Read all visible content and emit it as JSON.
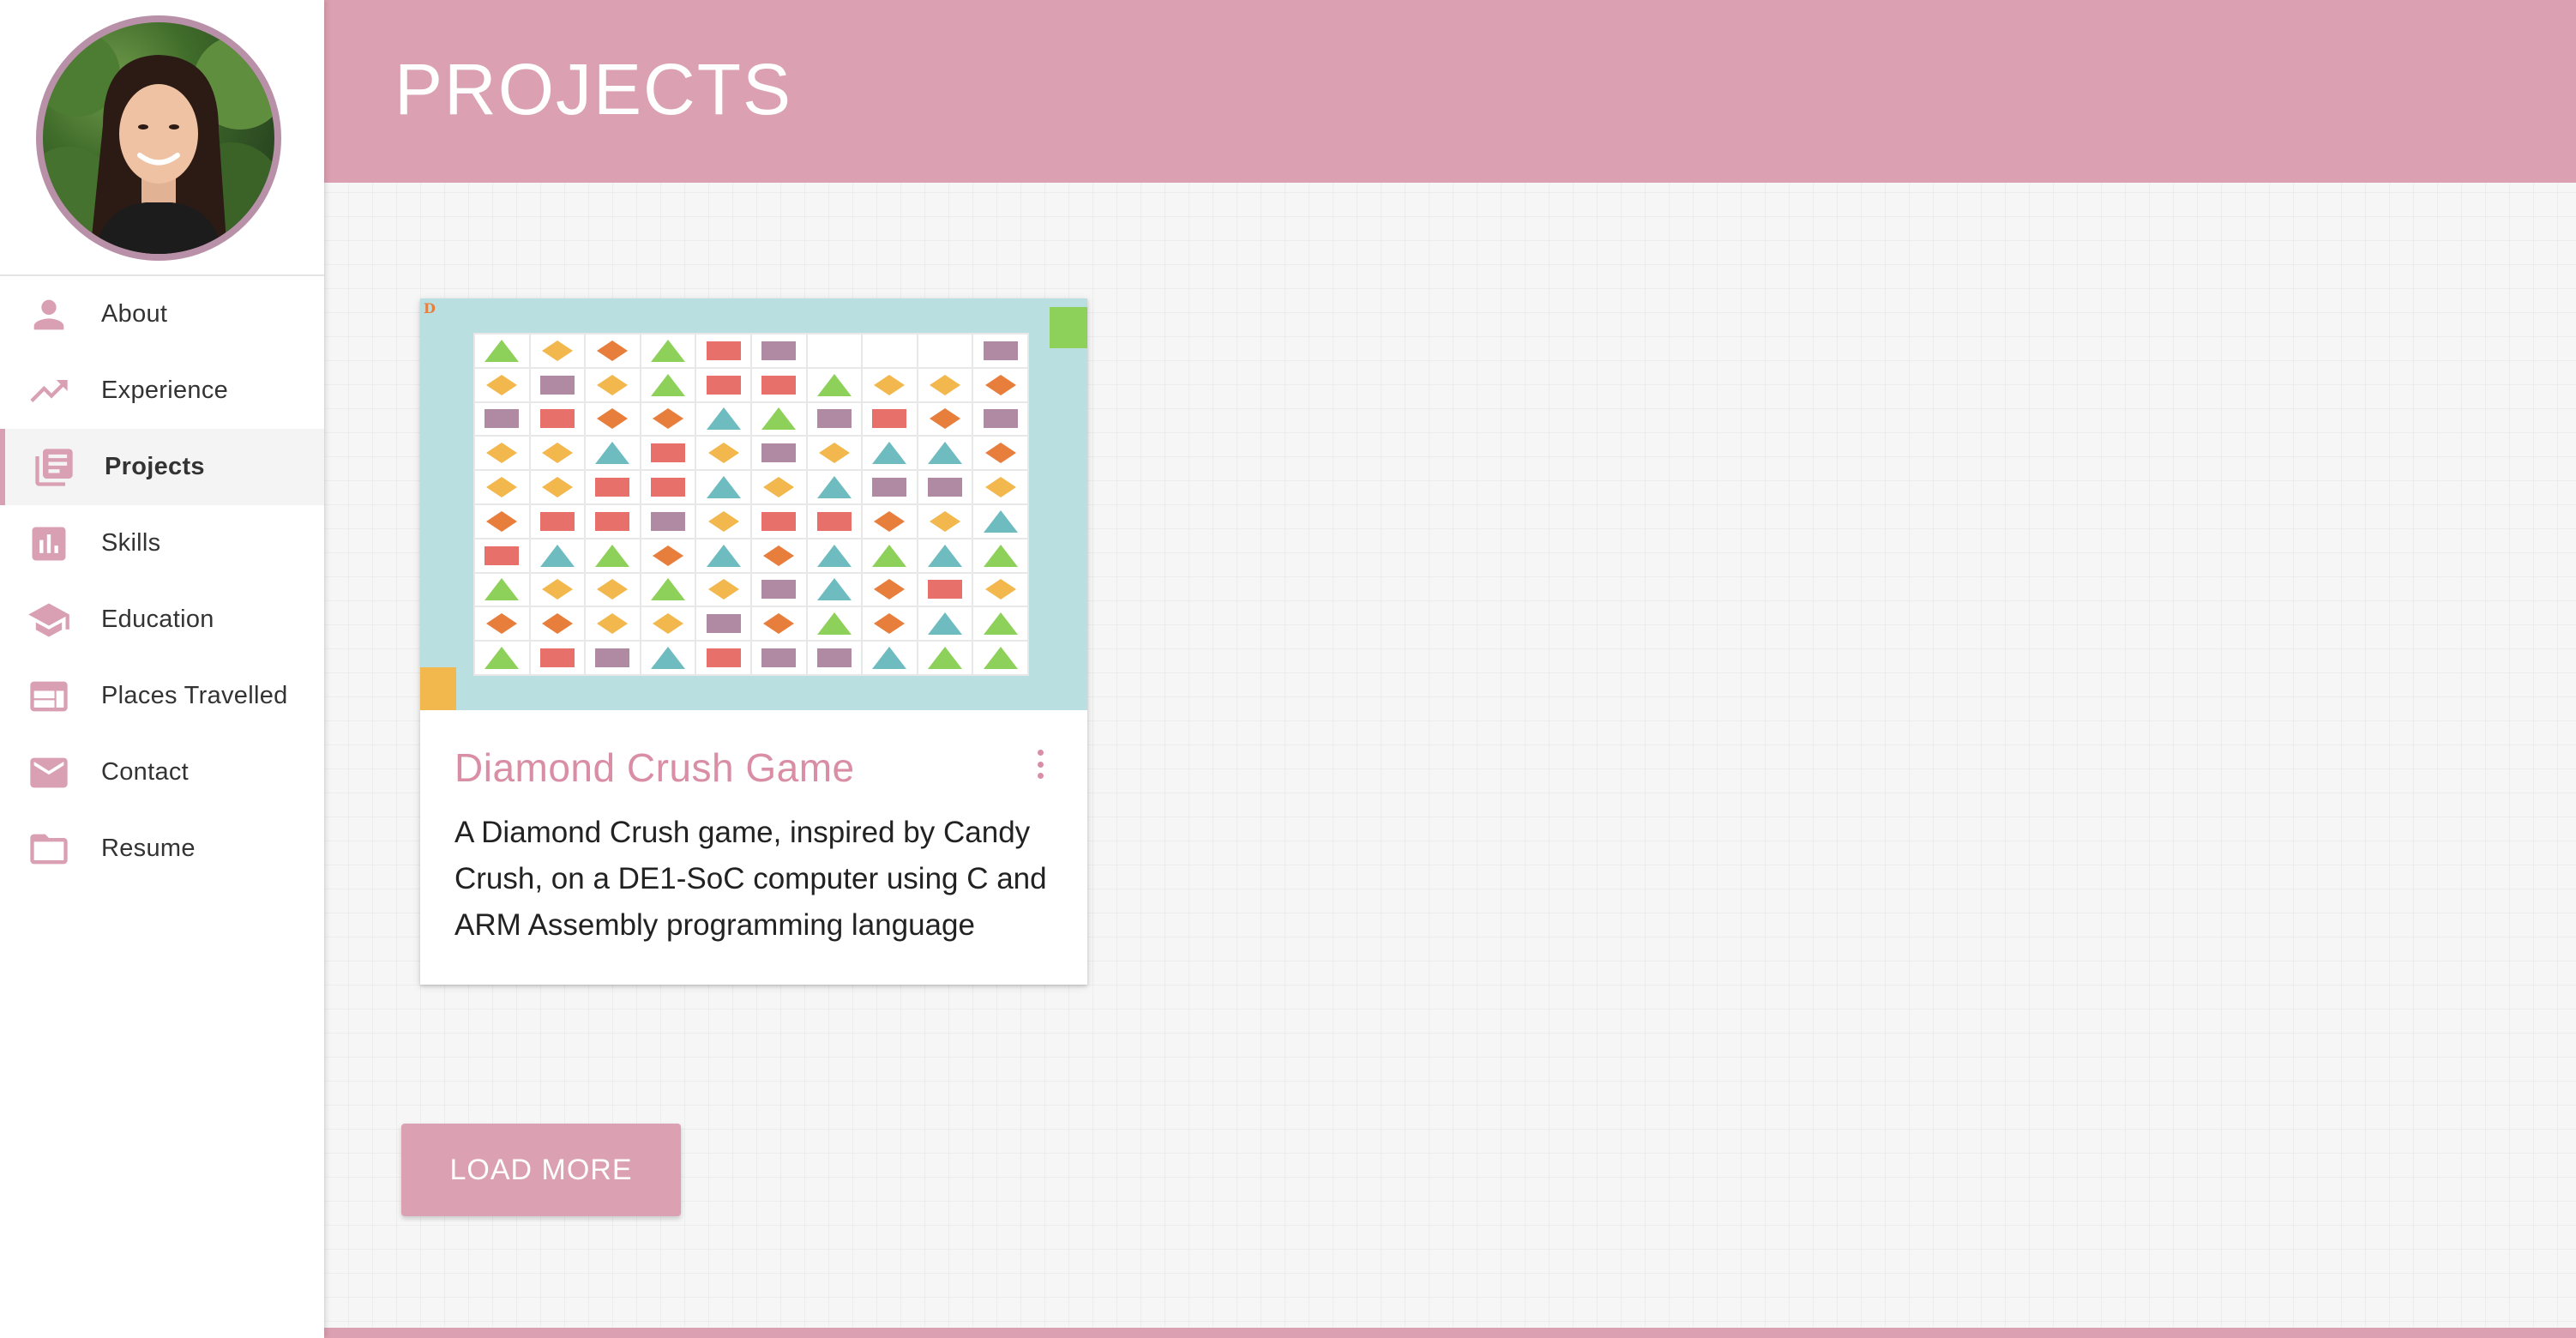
{
  "theme": {
    "accent": "#dba1b2",
    "accent_text": "#d98ea6",
    "icon": "#d9a0b4"
  },
  "sidebar": {
    "items": [
      {
        "label": "About",
        "icon": "person-icon"
      },
      {
        "label": "Experience",
        "icon": "trending-up-icon"
      },
      {
        "label": "Projects",
        "icon": "library-books-icon",
        "active": true
      },
      {
        "label": "Skills",
        "icon": "bar-chart-icon"
      },
      {
        "label": "Education",
        "icon": "school-icon"
      },
      {
        "label": "Places Travelled",
        "icon": "web-icon"
      },
      {
        "label": "Contact",
        "icon": "mail-icon"
      },
      {
        "label": "Resume",
        "icon": "folder-icon"
      }
    ]
  },
  "header": {
    "title": "PROJECTS"
  },
  "projects": [
    {
      "title": "Diamond Crush Game",
      "description": "A Diamond Crush game, inspired by Candy Crush, on a DE1-SoC computer using C and ARM Assembly programming language",
      "image_corner_letter": "D"
    }
  ],
  "actions": {
    "load_more": "LOAD MORE"
  }
}
